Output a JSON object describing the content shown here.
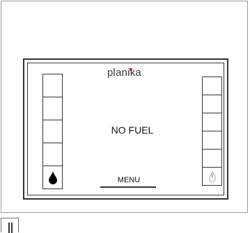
{
  "display": {
    "brand": "planika",
    "status_message": "NO FUEL",
    "menu_label": "MENU"
  },
  "left_gauge": {
    "segments": 5,
    "icon": "fuel-drop-icon",
    "icon_color": "#000000"
  },
  "right_gauge": {
    "segments": 6,
    "icon": "flame-icon",
    "icon_color": "#aaaaaa"
  },
  "controls": {
    "pause_icon": "pause-icon"
  },
  "colors": {
    "brand_accent": "#d0022b",
    "frame": "#333333"
  }
}
